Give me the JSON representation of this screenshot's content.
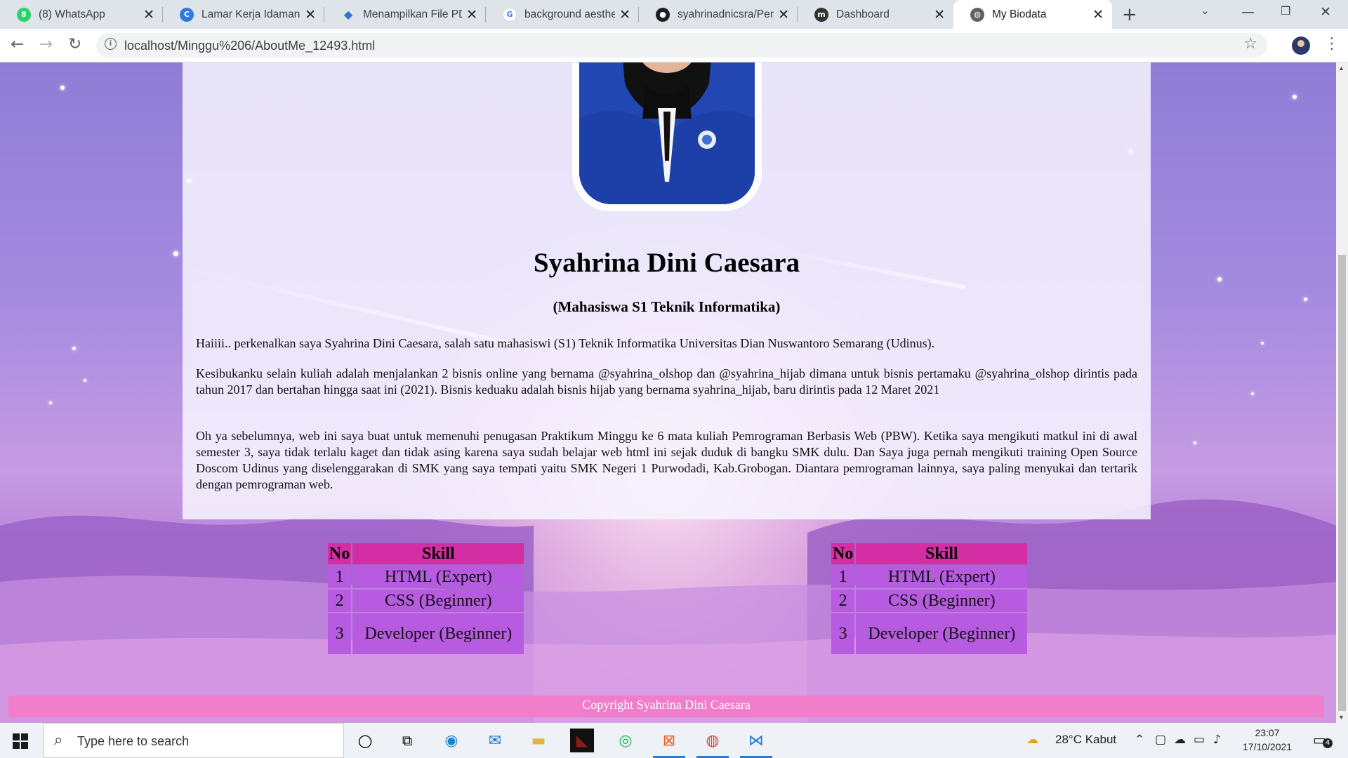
{
  "browser": {
    "tabs": [
      {
        "title": "(8) WhatsApp",
        "icon": "whatsapp-icon",
        "color": "#25d366",
        "glyph": "8"
      },
      {
        "title": "Lamar Kerja Idaman di",
        "icon": "c-logo-icon",
        "color": "#2d7be0",
        "glyph": "C"
      },
      {
        "title": "Menampilkan File PDF",
        "icon": "diamond-icon",
        "color": "#2a74d8",
        "glyph": "◆"
      },
      {
        "title": "background aesthetic",
        "icon": "google-icon",
        "color": "#4285f4",
        "glyph": "G"
      },
      {
        "title": "syahrinadnicsra/Pem",
        "icon": "github-icon",
        "color": "#1b1f23",
        "glyph": "●"
      },
      {
        "title": "Dashboard",
        "icon": "moodle-icon",
        "color": "#333333",
        "glyph": "m"
      },
      {
        "title": "My Biodata",
        "icon": "globe-icon",
        "color": "#5f6368",
        "glyph": "◍"
      }
    ],
    "url": "localhost/Minggu%206/AboutMe_12493.html"
  },
  "page": {
    "name": "Syahrina Dini Caesara",
    "subtitle": "(Mahasiswa S1 Teknik Informatika)",
    "paragraphs": [
      "Haiiii.. perkenalkan saya Syahrina Dini Caesara, salah satu mahasiswi (S1) Teknik Informatika Universitas Dian Nuswantoro Semarang (Udinus).",
      "Kesibukanku selain kuliah adalah menjalankan 2 bisnis online yang bernama @syahrina_olshop dan @syahrina_hijab dimana untuk bisnis pertamaku @syahrina_olshop dirintis pada tahun 2017 dan bertahan hingga saat ini (2021). Bisnis keduaku adalah bisnis hijab yang bernama syahrina_hijab, baru dirintis pada 12 Maret 2021",
      "Oh ya sebelumnya, web ini saya buat untuk memenuhi penugasan Praktikum Minggu ke 6 mata kuliah Pemrograman Berbasis Web (PBW). Ketika saya mengikuti matkul ini di awal semester 3, saya tidak terlalu kaget dan tidak asing karena saya sudah belajar web html ini sejak duduk di bangku SMK dulu. Dan Saya juga pernah mengikuti training Open Source Doscom Udinus yang diselenggarakan di SMK yang saya tempati yaitu SMK Negeri 1 Purwodadi, Kab.Grobogan. Diantara pemrograman lainnya, saya paling menyukai dan tertarik dengan pemrograman web."
    ],
    "skill_table": {
      "headers": [
        "No",
        "Skill"
      ],
      "rows": [
        [
          "1",
          "HTML (Expert)"
        ],
        [
          "2",
          "CSS (Beginner)"
        ],
        [
          "3",
          "Developer (Beginner)"
        ]
      ]
    },
    "footer": "Copyright Syahrina Dini Caesara"
  },
  "taskbar": {
    "search_placeholder": "Type here to search",
    "weather": "28°C  Kabut",
    "time": "23:07",
    "date": "17/10/2021",
    "notification_count": "4"
  },
  "colors": {
    "table_header": "#d42ea5",
    "table_cell": "#b75be0",
    "footer": "#f07ecb",
    "card": "#f7f4ff"
  }
}
